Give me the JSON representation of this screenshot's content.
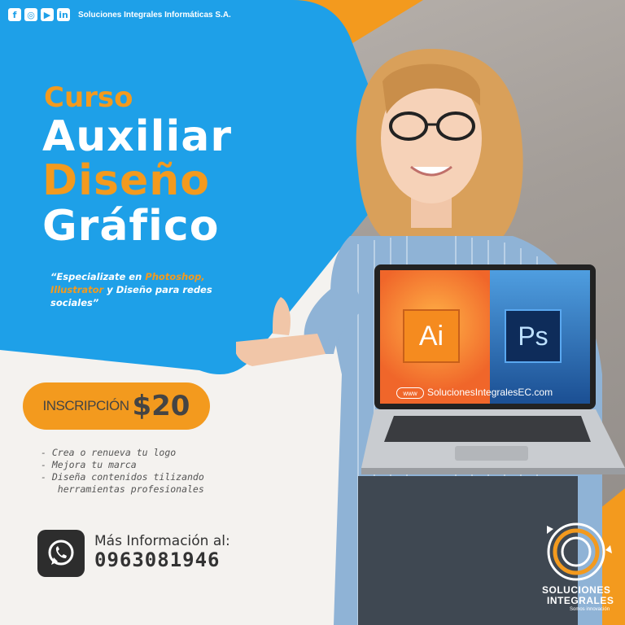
{
  "header": {
    "social_icons": [
      {
        "name": "facebook-icon",
        "glyph": "f"
      },
      {
        "name": "instagram-icon",
        "glyph": "◎"
      },
      {
        "name": "youtube-icon",
        "glyph": "▶"
      },
      {
        "name": "linkedin-icon",
        "glyph": "in"
      }
    ],
    "company": "Soluciones Integrales Informáticas S.A."
  },
  "title": {
    "curso": "Curso",
    "line1": "Auxiliar",
    "line2": "Diseño",
    "line3": "Gráfico"
  },
  "quote": {
    "part1": "“Especializate en ",
    "hl1": "Photoshop, Illustrator",
    "part2": " y Diseño para redes sociales”"
  },
  "pricing": {
    "label": "INSCRIPCIÓN",
    "price": "$20"
  },
  "bullets": [
    "- Crea o renueva tu logo",
    "- Mejora tu marca",
    "- Diseña contenidos tilizando",
    "   herramientas profesionales"
  ],
  "contact": {
    "label": "Más Información al:",
    "phone": "0963081946"
  },
  "laptop": {
    "ai_label": "Ai",
    "ps_label": "Ps",
    "www_label": "www",
    "website": "SolucionesIntegralesEC.com"
  },
  "logo": {
    "line1": "SOLUCIONES",
    "line2": "INTEGRALES",
    "tagline": "Somos innovación"
  },
  "colors": {
    "blue": "#1ea0e8",
    "orange": "#f39a1e",
    "dark": "#2d2d2d"
  }
}
